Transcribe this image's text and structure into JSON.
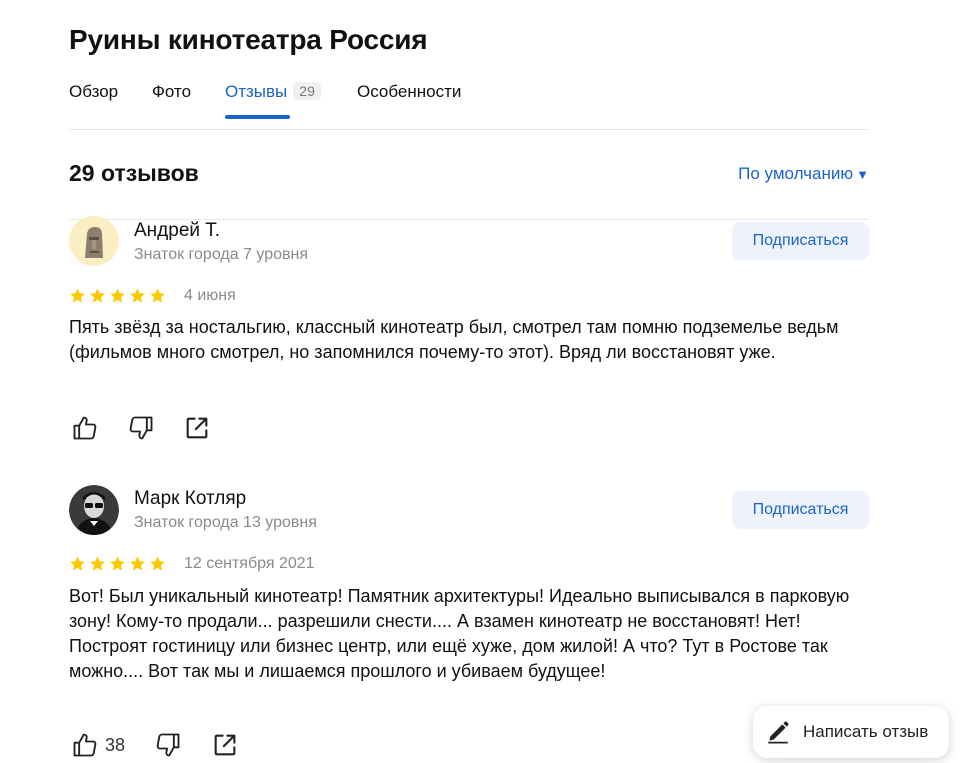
{
  "place": {
    "title": "Руины кинотеатра Россия"
  },
  "tabs": [
    {
      "label": "Обзор"
    },
    {
      "label": "Фото"
    },
    {
      "label": "Отзывы",
      "count": "29",
      "active": true
    },
    {
      "label": "Особенности"
    }
  ],
  "reviews_header": {
    "count_label": "29 отзывов",
    "sort_label": "По умолчанию"
  },
  "icons": {
    "sort_caret": "caret-down-icon",
    "star": "star-icon",
    "like": "thumbs-up-icon",
    "dislike": "thumbs-down-icon",
    "share": "share-icon",
    "write": "pencil-icon"
  },
  "colors": {
    "accent": "#1a63c7",
    "star": "#fcc900",
    "subscribe_bg": "#eef3fb"
  },
  "reviews": [
    {
      "author": "Андрей Т.",
      "level": "Знаток города 7 уровня",
      "rating": 5,
      "date": "4 июня",
      "text": "Пять звёзд за ностальгию, классный кинотеатр был, смотрел там помню подземелье ведьм (фильмов много смотрел, но запомнился почему-то этот). Вряд ли восстановят уже.",
      "subscribe_label": "Подписаться",
      "likes": ""
    },
    {
      "author": "Марк Котляр",
      "level": "Знаток города 13 уровня",
      "rating": 5,
      "date": "12 сентября 2021",
      "text": "Вот! Был уникальный кинотеатр! Памятник архитектуры! Идеально выписывался в парковую зону! Кому-то продали... разрешили снести.... А взамен кинотеатр не восстановят! Нет! Построят гостиницу или бизнес центр, или ещё хуже, дом жилой! А что? Тут в Ростове так можно.... Вот так мы и лишаемся прошлого и убиваем будущее!",
      "subscribe_label": "Подписаться",
      "likes": "38"
    }
  ],
  "write_review": {
    "label": "Написать отзыв"
  }
}
